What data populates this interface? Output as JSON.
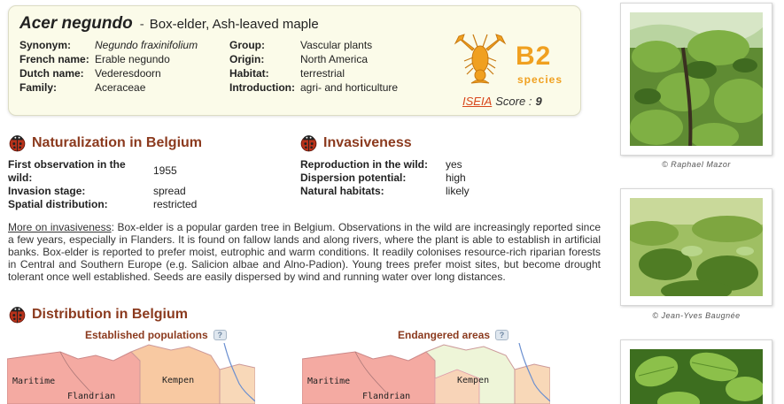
{
  "species": {
    "scientific_name": "Acer negundo",
    "separator": "-",
    "common_names": "Box-elder, Ash-leaved maple"
  },
  "properties_left": [
    {
      "label": "Synonym:",
      "value": "Negundo fraxinifolium"
    },
    {
      "label": "French name:",
      "value": "Erable negundo"
    },
    {
      "label": "Dutch name:",
      "value": "Vederesdoorn"
    },
    {
      "label": "Family:",
      "value": "Aceraceae"
    }
  ],
  "properties_mid": [
    {
      "label": "Group:",
      "value": "Vascular plants"
    },
    {
      "label": "Origin:",
      "value": "North America"
    },
    {
      "label": "Habitat:",
      "value": "terrestrial"
    },
    {
      "label": "Introduction:",
      "value": "agri- and horticulture"
    }
  ],
  "badge": {
    "category": "B2",
    "subtitle": "species",
    "iseia_label": "ISEIA",
    "score_label": "Score :",
    "score_value": "9",
    "color": "#f0a020",
    "icon": "crayfish-icon"
  },
  "naturalization": {
    "title": "Naturalization in Belgium",
    "rows": [
      {
        "label": "First observation in the",
        "label2": "wild:",
        "value": "1955"
      },
      {
        "label": "Invasion stage:",
        "value": "spread"
      },
      {
        "label": "Spatial distribution:",
        "value": "restricted"
      }
    ]
  },
  "invasiveness": {
    "title": "Invasiveness",
    "rows": [
      {
        "label": "Reproduction in the wild:",
        "value": "yes"
      },
      {
        "label": "Dispersion potential:",
        "value": "high"
      },
      {
        "label": "Natural habitats:",
        "value": "likely"
      }
    ]
  },
  "description": {
    "link_text": "More on invasiveness",
    "text": ": Box-elder is a popular garden tree in Belgium. Observations in the wild are increasingly reported since a few years, especially in Flanders. It is found on fallow lands and along rivers, where the plant is able to establish in artificial banks. Box-elder is reported to prefer moist, eutrophic and warm conditions. It readily colonises resource-rich riparian forests in Central and Southern Europe (e.g. Salicion albae and Alno-Padion). Young trees prefer moist sites, but become drought tolerant once well established. Seeds are easily dispersed by wind and running water over long distances."
  },
  "distribution": {
    "title": "Distribution in Belgium",
    "maps": [
      {
        "title": "Established populations",
        "regions": [
          "Maritime",
          "Flandrian",
          "Kempen"
        ]
      },
      {
        "title": "Endangered areas",
        "regions": [
          "Maritime",
          "Flandrian",
          "Kempen"
        ]
      }
    ]
  },
  "photos": [
    {
      "caption": "© Raphael Mazor"
    },
    {
      "caption": "© Jean-Yves Baugnée"
    },
    {
      "caption": ""
    }
  ],
  "colors": {
    "accent_title": "#8b3a1e",
    "iseia_red": "#d8451a",
    "box_bg": "#fbfbe9"
  }
}
